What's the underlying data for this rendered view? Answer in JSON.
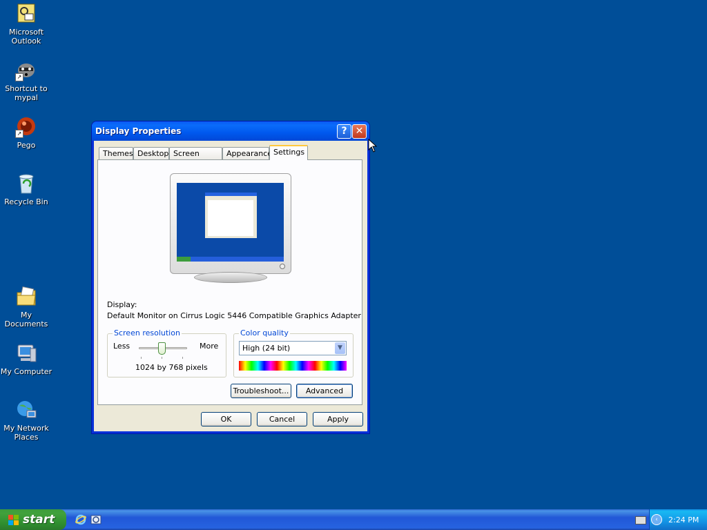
{
  "desktop": {
    "icons": [
      {
        "label": "Microsoft\nOutlook",
        "icon": "outlook-icon"
      },
      {
        "label": "Shortcut to\nmypal",
        "icon": "mypal-raccoon-icon"
      },
      {
        "label": "Pego",
        "icon": "pego-icon"
      },
      {
        "label": "Recycle Bin",
        "icon": "recycle-bin-icon"
      },
      {
        "label": "My Documents",
        "icon": "my-documents-icon"
      },
      {
        "label": "My Computer",
        "icon": "my-computer-icon"
      },
      {
        "label": "My Network\nPlaces",
        "icon": "network-places-icon"
      }
    ]
  },
  "window": {
    "title": "Display Properties",
    "help_label": "?",
    "close_label": "✕",
    "tabs": [
      "Themes",
      "Desktop",
      "Screen Saver",
      "Appearance",
      "Settings"
    ],
    "active_tab": "Settings",
    "display_label": "Display:",
    "display_value": "Default Monitor on Cirrus Logic 5446 Compatible Graphics Adapter",
    "resolution": {
      "title": "Screen resolution",
      "less": "Less",
      "more": "More",
      "value": "1024 by 768 pixels"
    },
    "color_quality": {
      "title": "Color quality",
      "selected": "High (24 bit)"
    },
    "troubleshoot_label": "Troubleshoot...",
    "advanced_label": "Advanced",
    "ok_label": "OK",
    "cancel_label": "Cancel",
    "apply_label": "Apply"
  },
  "taskbar": {
    "start_label": "start",
    "clock": "2:24 PM"
  },
  "colors": {
    "desktop": "#004e98",
    "title_bar": "#0058ee",
    "start_button": "#3c9c3c",
    "tray": "#1493e5"
  }
}
